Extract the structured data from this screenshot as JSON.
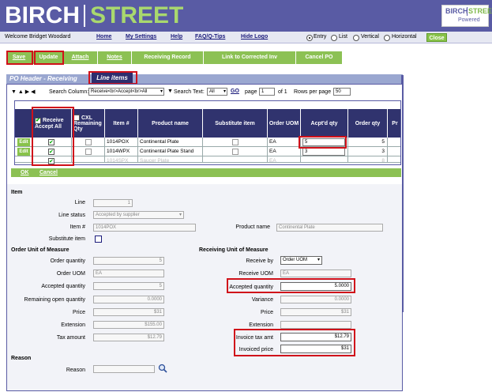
{
  "header": {
    "brand_left": "BIRCH",
    "brand_right": "STREET",
    "powered_left": "BIRCH",
    "powered_right": "STREET",
    "powered_label": "Powered"
  },
  "nav": {
    "welcome": "Welcome Bridget Woodard",
    "links": [
      "Home",
      "My Settings",
      "Help",
      "FAQ/Q-Tips",
      "Hide Logo"
    ],
    "views": [
      "Entry",
      "List",
      "Vertical",
      "Horizontal"
    ],
    "selected_view": "Entry",
    "close": "Close"
  },
  "toolbar": {
    "save": "Save",
    "update": "Update",
    "attach": "Attach",
    "notes": "Notes",
    "receiving_record": "Receiving Record",
    "link_corrected": "Link to Corrected Inv",
    "cancel_po": "Cancel PO"
  },
  "tabs": {
    "po_header": "PO Header - Receiving",
    "line_items": "Line items"
  },
  "pager": {
    "search_column_label": "Search Column:",
    "search_column_value": "Receive<br>Accept<br>All",
    "search_text_label": "Search Text:",
    "search_text_value": "All",
    "go": "GO",
    "page_label": "page",
    "page_value": "1",
    "of_label": "of 1",
    "rows_label": "Rows per page",
    "rows_value": "50"
  },
  "grid": {
    "headers": {
      "receive_top": "Receive",
      "receive_bottom": "Accept All",
      "cxl_top": "CXL",
      "cxl_bottom": "Remaining Qty",
      "item": "Item #",
      "product": "Product name",
      "substitute": "Substitute item",
      "uom": "Order UOM",
      "acpt": "Acpt'd qty",
      "order_qty": "Order qty",
      "pr": "Pr"
    },
    "edit_label": "Edit",
    "rows": [
      {
        "item": "1014POX",
        "product": "Continental Plate",
        "uom": "EA",
        "acpt": "5",
        "order_qty": "5"
      },
      {
        "item": "1014WPX",
        "product": "Continental Plate Stand",
        "uom": "EA",
        "acpt": "3",
        "order_qty": "3"
      },
      {
        "item": "1014SPX",
        "product": "Saucer Plate",
        "uom": "EA",
        "acpt": "",
        "order_qty": "8"
      }
    ]
  },
  "actions": {
    "ok": "OK",
    "cancel": "Cancel"
  },
  "item": {
    "section": "Item",
    "line_label": "Line",
    "line_value": "1",
    "status_label": "Line status",
    "status_value": "Accepted by supplier",
    "itemno_label": "Item #",
    "itemno_value": "1014POX",
    "product_label": "Product name",
    "product_value": "Continental Plate",
    "substitute_label": "Substitute item"
  },
  "order_uom": {
    "section": "Order Unit of Measure",
    "qty_label": "Order quantity",
    "qty_value": "5",
    "uom_label": "Order UOM",
    "uom_value": "EA",
    "accepted_label": "Accepted quantity",
    "accepted_value": "5",
    "remaining_label": "Remaining open quantity",
    "remaining_value": "0.0000",
    "price_label": "Price",
    "price_value": "$31",
    "extension_label": "Extension",
    "extension_value": "$155.00",
    "tax_label": "Tax amount",
    "tax_value": "$12.79"
  },
  "receiving_uom": {
    "section": "Receiving Unit of Measure",
    "receive_by_label": "Receive by",
    "receive_by_value": "Order UOM",
    "receive_uom_label": "Receive UOM",
    "receive_uom_value": "EA",
    "accepted_label": "Accepted quantity",
    "accepted_value": "5.0000",
    "variance_label": "Variance",
    "variance_value": "0.0000",
    "price_label": "Price",
    "price_value": "$31",
    "extension_label": "Extension",
    "extension_value": "",
    "invoice_tax_label": "Invoice tax amt",
    "invoice_tax_value": "$12.79",
    "invoiced_price_label": "Invoiced price",
    "invoiced_price_value": "$31"
  },
  "reason": {
    "section": "Reason",
    "label": "Reason",
    "value": ""
  }
}
